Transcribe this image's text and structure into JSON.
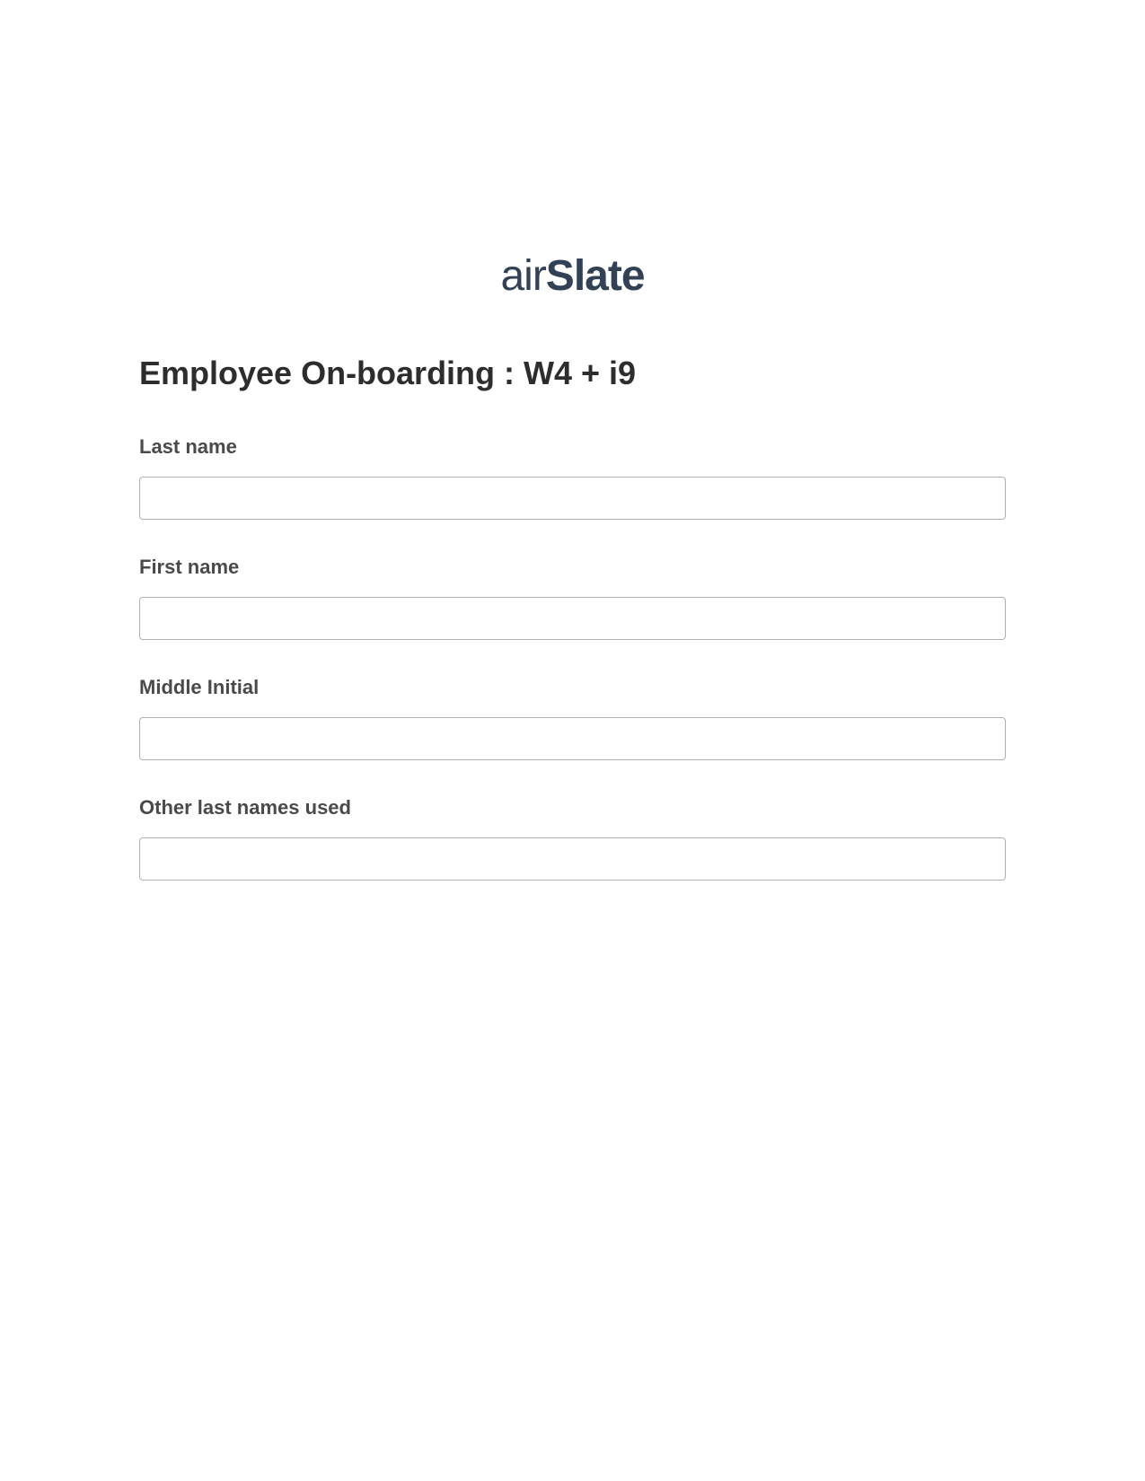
{
  "logo": {
    "part1": "air",
    "part2": "Slate"
  },
  "form": {
    "title": "Employee On-boarding : W4 + i9",
    "fields": [
      {
        "label": "Last name",
        "value": ""
      },
      {
        "label": "First name",
        "value": ""
      },
      {
        "label": "Middle Initial",
        "value": ""
      },
      {
        "label": "Other last names used",
        "value": ""
      }
    ]
  }
}
